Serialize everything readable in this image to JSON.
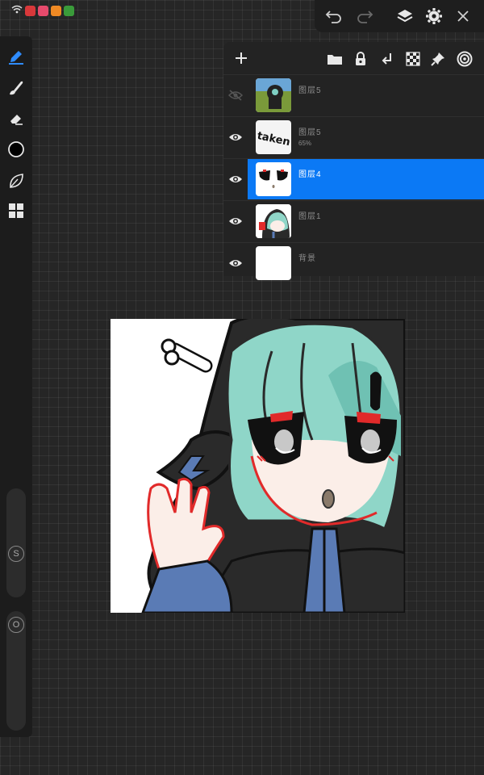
{
  "status_bar": {
    "icons": [
      "wifi-icon",
      "alarm-icon",
      "mute-icon",
      "battery-icon"
    ],
    "app_badge_colors": [
      "#d8383a",
      "#e64a6c",
      "#f08a24",
      "#3a9b3a"
    ]
  },
  "top_toolbar": {
    "icons": [
      "undo-icon",
      "redo-icon",
      "layers-icon",
      "settings-icon",
      "close-icon"
    ]
  },
  "left_toolbar": {
    "tools": [
      "pen-icon",
      "brush-icon",
      "eraser-icon",
      "color-swatch",
      "leaf-icon",
      "grid-icon"
    ],
    "active_color": "#000000",
    "size_slider_label": "S",
    "opacity_slider_label": "O",
    "accent": "#2f8cff"
  },
  "layers_panel": {
    "header_icons": [
      "add-layer-icon",
      "folder-icon",
      "lock-icon",
      "merge-down-icon",
      "checker-icon",
      "pin-icon",
      "target-icon"
    ],
    "selected_color": "#0b79f5",
    "layers": [
      {
        "name": "图层5",
        "opacity_text": "",
        "visible": false,
        "selected": false
      },
      {
        "name": "图层5",
        "opacity_text": "65%",
        "visible": true,
        "selected": false
      },
      {
        "name": "图层4",
        "opacity_text": "",
        "visible": true,
        "selected": true
      },
      {
        "name": "图层1",
        "opacity_text": "",
        "visible": true,
        "selected": false
      },
      {
        "name": "背景",
        "opacity_text": "",
        "visible": true,
        "selected": false
      }
    ],
    "thumbnail_text_taken": "taken"
  },
  "canvas": {
    "background": "#ffffff",
    "hair_color": "#8fd6c8",
    "hood_color": "#2a2a2a",
    "accent_blue": "#5a7bb5",
    "accent_red": "#e12a2a"
  }
}
